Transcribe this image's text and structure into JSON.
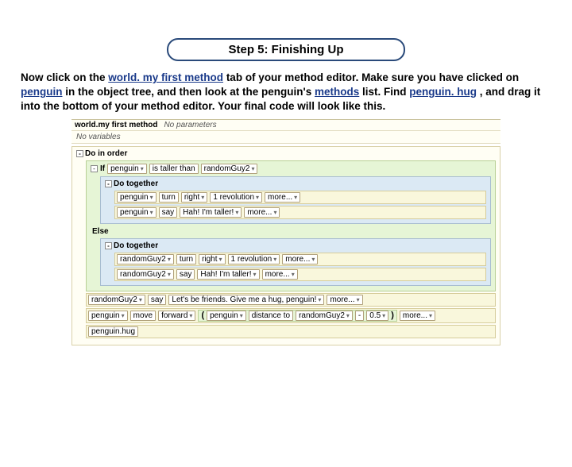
{
  "header": {
    "title": "Step 5: Finishing Up"
  },
  "instructions": {
    "t1": "Now click on the ",
    "l1": "world. my first method",
    "t2": " tab of your method editor. Make sure you have clicked on ",
    "l2": "penguin",
    "t3": " in the object tree, and then look at the penguin's ",
    "l3": "methods",
    "t4": " list. Find ",
    "l4": "penguin. hug",
    "t5": ", and drag it into the bottom of your method editor. Your final code will look like this."
  },
  "editor": {
    "methodName": "world.my first method",
    "noParams": "No parameters",
    "noVars": "No variables",
    "doInOrder": "Do in order",
    "ifLabel": "If",
    "elseLabel": "Else",
    "doTogether": "Do together",
    "penguin": "penguin",
    "isTaller": "is taller than",
    "randomGuy2": "randomGuy2",
    "turn": "turn",
    "right": "right",
    "rev1": "1 revolution",
    "more": "more...",
    "say": "say",
    "hah": "Hah! I'm taller!",
    "friends": "Let's be friends. Give me a hug, penguin!",
    "move": "move",
    "forward": "forward",
    "distanceTo": "distance to",
    "minus": "-",
    "half": "0.5",
    "penguinHug": "penguin.hug"
  }
}
